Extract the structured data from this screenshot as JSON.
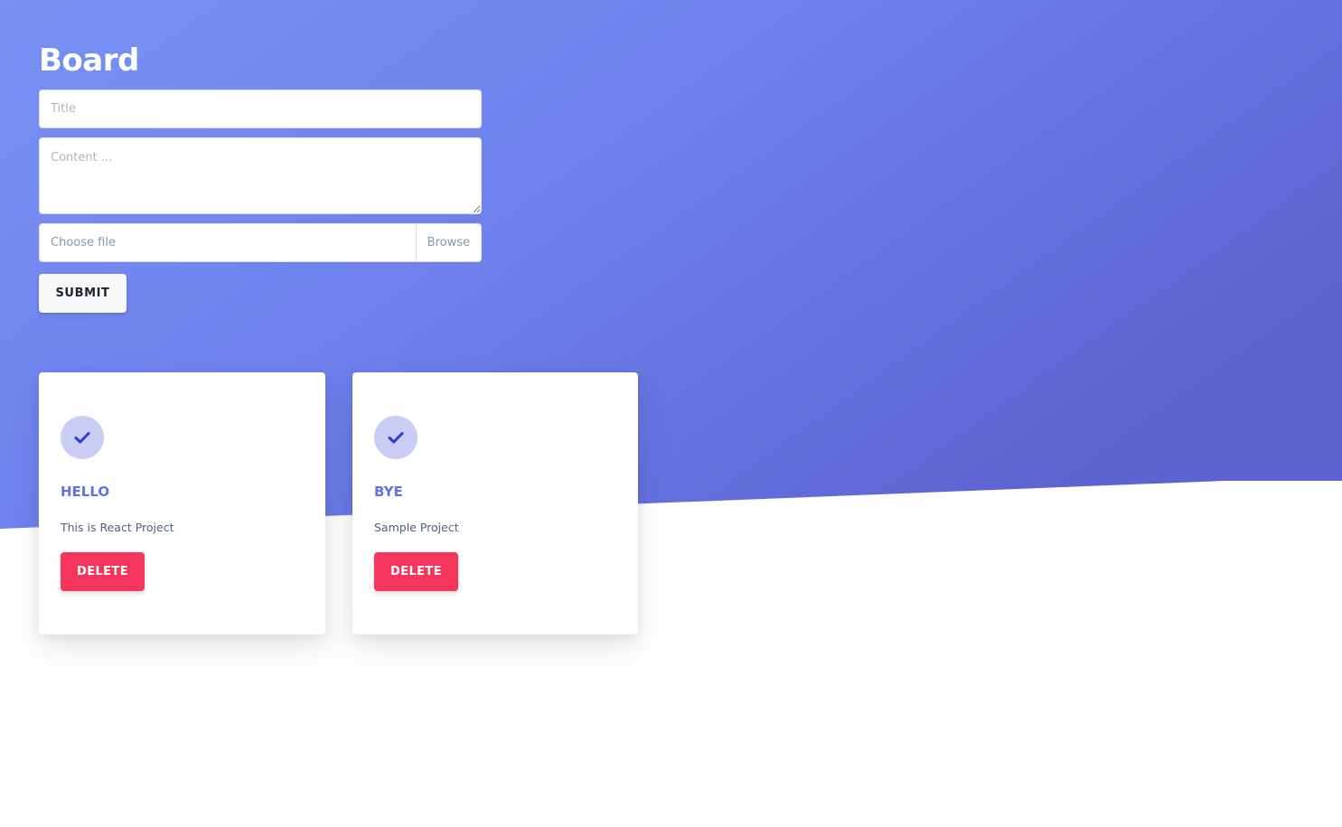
{
  "page": {
    "title": "Board"
  },
  "form": {
    "title_placeholder": "Title",
    "content_placeholder": "Content ...",
    "file_label": "Choose file",
    "browse_label": "Browse",
    "submit_label": "SUBMIT"
  },
  "cards": [
    {
      "icon": "check-icon",
      "title": "HELLO",
      "description": "This is React Project",
      "delete_label": "DELETE"
    },
    {
      "icon": "check-icon",
      "title": "BYE",
      "description": "Sample Project",
      "delete_label": "DELETE"
    }
  ],
  "colors": {
    "gradient_start": "#7891f2",
    "gradient_end": "#5d63d1",
    "accent": "#5e72e4",
    "icon_bg": "#c9cdf4",
    "icon_check": "#2d3ad8",
    "danger": "#f5365c",
    "text_muted": "#525f7f"
  }
}
